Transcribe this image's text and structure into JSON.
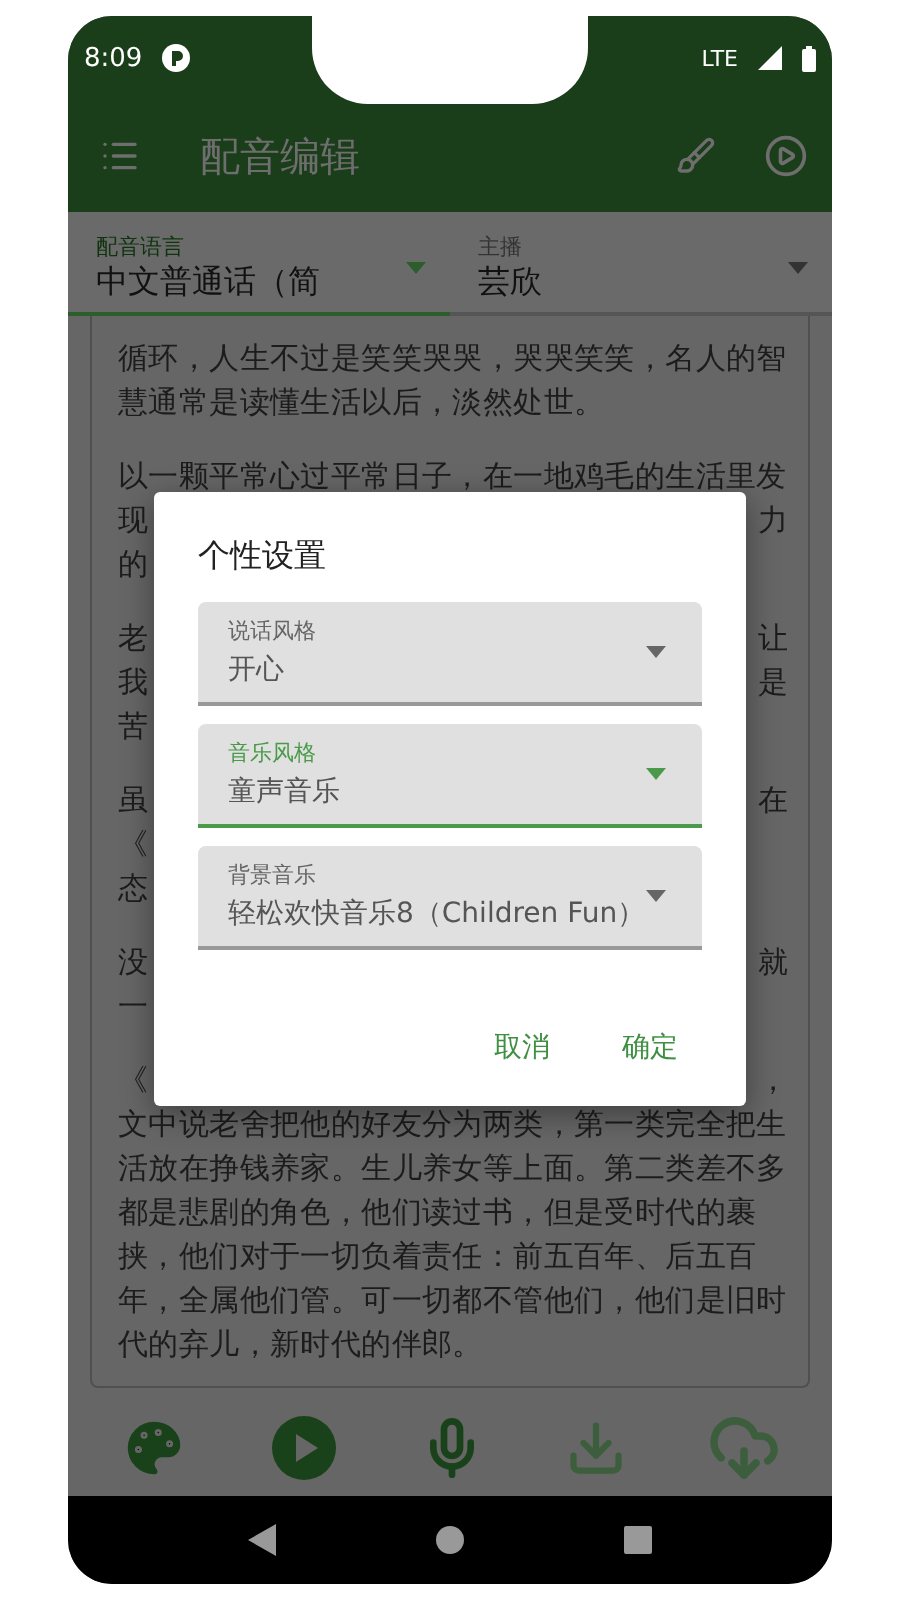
{
  "status_bar": {
    "time": "8:09",
    "network": "LTE"
  },
  "toolbar": {
    "title": "配音编辑"
  },
  "spinners": [
    {
      "label": "配音语言",
      "value": "中文普通话（简",
      "focused": true
    },
    {
      "label": "主播",
      "value": "芸欣",
      "focused": false
    }
  ],
  "body": {
    "paragraphs": [
      [
        [
          "循环，人生不过是笑笑哭哭，哭哭笑笑，名人的智"
        ],
        [
          "慧通常是读懂生活以后，淡然处世。"
        ]
      ],
      [
        [
          "以一颗平常心过平常日子，在一地鸡毛的生活里发"
        ],
        [
          "现",
          "力"
        ],
        [
          "的"
        ]
      ],
      [
        [
          "老",
          "让"
        ],
        [
          "我",
          "是"
        ],
        [
          "苦"
        ]
      ],
      [
        [
          "虽",
          "在"
        ],
        [
          "《"
        ],
        [
          "态"
        ]
      ],
      [
        [
          "没",
          "就"
        ],
        [
          "一"
        ]
      ],
      [
        [
          "《",
          "，"
        ],
        [
          "文中说老舍把他的好友分为两类，第一类完全把生"
        ],
        [
          "活放在挣钱养家。生儿养女等上面。第二类差不多"
        ],
        [
          "都是悲剧的角色，他们读过书，但是受时代的裹"
        ],
        [
          "挟，他们对于一切负着责任：前五百年、后五百"
        ],
        [
          "年，全属他们管。可一切都不管他们，他们是旧时"
        ],
        [
          "代的弃儿，新时代的伴郎。"
        ]
      ]
    ]
  },
  "dialog": {
    "title": "个性设置",
    "fields": [
      {
        "label": "说话风格",
        "value": "开心",
        "focused": false
      },
      {
        "label": "音乐风格",
        "value": "童声音乐",
        "focused": true
      },
      {
        "label": "背景音乐",
        "value": "轻松欢快音乐8（Children Fun）",
        "focused": false
      }
    ],
    "buttons": [
      "取消",
      "确定"
    ]
  }
}
